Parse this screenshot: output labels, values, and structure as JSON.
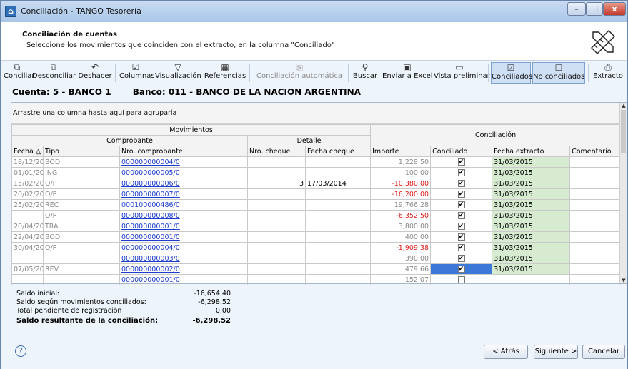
{
  "window": {
    "title": "Conciliación - TANGO Tesorería",
    "controls": {
      "minimize": "–",
      "maximize": "☐",
      "close": "x"
    }
  },
  "header": {
    "title": "Conciliación de cuentas",
    "subtitle": "Seleccione los movimientos que coinciden con el extracto, en la columna \"Conciliado\""
  },
  "toolbar": {
    "items": [
      {
        "label": "Conciliar",
        "icon": "conciliar-icon",
        "glyph": "⧉"
      },
      {
        "label": "Desconciliar",
        "icon": "desconciliar-icon",
        "glyph": "⧉"
      },
      {
        "label": "Deshacer",
        "icon": "undo-icon",
        "glyph": "↶"
      },
      {
        "label": "Columnas",
        "icon": "columns-icon",
        "glyph": "☑"
      },
      {
        "label": "Visualización",
        "icon": "filter-icon",
        "glyph": "▽"
      },
      {
        "label": "Referencias",
        "icon": "grid-icon",
        "glyph": "▦"
      },
      {
        "label": "Conciliación automática",
        "icon": "auto-conciliation-icon",
        "glyph": "⎘"
      },
      {
        "label": "Buscar",
        "icon": "binoculars-icon",
        "glyph": "⚲"
      },
      {
        "label": "Enviar a Excel",
        "icon": "excel-icon",
        "glyph": "▣"
      },
      {
        "label": "Vista preliminar",
        "icon": "monitor-icon",
        "glyph": "▭"
      },
      {
        "label": "Conciliados",
        "icon": "checkbox-checked-icon",
        "glyph": "☑"
      },
      {
        "label": "No conciliados",
        "icon": "checkbox-empty-icon",
        "glyph": "☐"
      },
      {
        "label": "Extracto",
        "icon": "extracto-icon",
        "glyph": "⎙"
      }
    ]
  },
  "account": {
    "cuenta": "Cuenta:  5 - BANCO 1",
    "banco": "Banco: 011 - BANCO DE LA NACION ARGENTINA"
  },
  "grid": {
    "group_hint": "Arrastre una columna hasta aquí para agruparla",
    "band_movimientos": "Movimientos",
    "band_comprobante": "Comprobante",
    "band_detalle": "Detalle",
    "band_conciliacion": "Conciliación",
    "columns": {
      "fecha": "Fecha △",
      "tipo": "Tipo",
      "nro": "Nro. comprobante",
      "cheque": "Nro. cheque",
      "fecha_cheque": "Fecha cheque",
      "importe": "Importe",
      "conciliado": "Conciliado",
      "fecha_extracto": "Fecha extracto",
      "comentario": "Comentario"
    },
    "rows": [
      {
        "fecha": "18/12/20",
        "tipo": "BOD",
        "nro": "000000000004/0",
        "cheque": "",
        "fecha_cheque": "",
        "importe": "1,228.50",
        "conciliado": "✔",
        "fecha_extracto": "31/03/2015"
      },
      {
        "fecha": "01/01/20",
        "tipo": "ING",
        "nro": "000000000005/0",
        "cheque": "",
        "fecha_cheque": "",
        "importe": "100.00",
        "conciliado": "✔",
        "fecha_extracto": "31/03/2015"
      },
      {
        "fecha": "15/02/20",
        "tipo": "O/P",
        "nro": "000000000006/0",
        "cheque": "3",
        "fecha_cheque": "17/03/2014",
        "importe": "-10,380.00",
        "conciliado": "✔",
        "fecha_extracto": "31/03/2015"
      },
      {
        "fecha": "20/02/20",
        "tipo": "O/P",
        "nro": "000000000007/0",
        "cheque": "",
        "fecha_cheque": "",
        "importe": "-16,200.00",
        "conciliado": "✔",
        "fecha_extracto": "31/03/2015"
      },
      {
        "fecha": "25/02/20",
        "tipo": "REC",
        "nro": "000100000486/0",
        "cheque": "",
        "fecha_cheque": "",
        "importe": "19,766.28",
        "conciliado": "✔",
        "fecha_extracto": "31/03/2015"
      },
      {
        "fecha": "",
        "tipo": "O/P",
        "nro": "000000000008/0",
        "cheque": "",
        "fecha_cheque": "",
        "importe": "-6,352.50",
        "conciliado": "✔",
        "fecha_extracto": "31/03/2015"
      },
      {
        "fecha": "20/04/20",
        "tipo": "TRA",
        "nro": "000000000001/0",
        "cheque": "",
        "fecha_cheque": "",
        "importe": "3,800.00",
        "conciliado": "✔",
        "fecha_extracto": "31/03/2015"
      },
      {
        "fecha": "22/04/20",
        "tipo": "BOD",
        "nro": "000000000001/0",
        "cheque": "",
        "fecha_cheque": "",
        "importe": "400.00",
        "conciliado": "✔",
        "fecha_extracto": "31/03/2015"
      },
      {
        "fecha": "30/04/20",
        "tipo": "O/P",
        "nro": "000000000004/0",
        "cheque": "",
        "fecha_cheque": "",
        "importe": "-1,909.38",
        "conciliado": "✔",
        "fecha_extracto": "31/03/2015"
      },
      {
        "fecha": "",
        "tipo": "",
        "nro": "000000000003/0",
        "cheque": "",
        "fecha_cheque": "",
        "importe": "390.00",
        "conciliado": "✔",
        "fecha_extracto": "31/03/2015"
      },
      {
        "fecha": "07/05/20",
        "tipo": "REV",
        "nro": "000000000002/0",
        "cheque": "",
        "fecha_cheque": "",
        "importe": "479.66",
        "conciliado": "✔",
        "fecha_extracto": "31/03/2015"
      },
      {
        "fecha": "",
        "tipo": "",
        "nro": "000000000001/0",
        "cheque": "",
        "fecha_cheque": "",
        "importe": "152.07",
        "conciliado": "",
        "fecha_extracto": ""
      }
    ]
  },
  "summary": {
    "saldo_inicial_label": "Saldo inicial:",
    "saldo_inicial": "-16,654.40",
    "saldo_conciliados_label": "Saldo según movimientos conciliados:",
    "saldo_conciliados": "-6,298.52",
    "pendiente_label": "Total pendiente de registración",
    "pendiente": "0.00",
    "resultante_label": "Saldo resultante de la conciliación:",
    "resultante": "-6,298.52"
  },
  "footer": {
    "help": "?",
    "back": "< Atrás",
    "next": "Siguiente >",
    "cancel": "Cancelar"
  },
  "colors": {
    "negative": "#e02020",
    "link": "#1a3ccf",
    "conciliated_cell": "#d6ebd0",
    "selection": "#3b78d8"
  }
}
